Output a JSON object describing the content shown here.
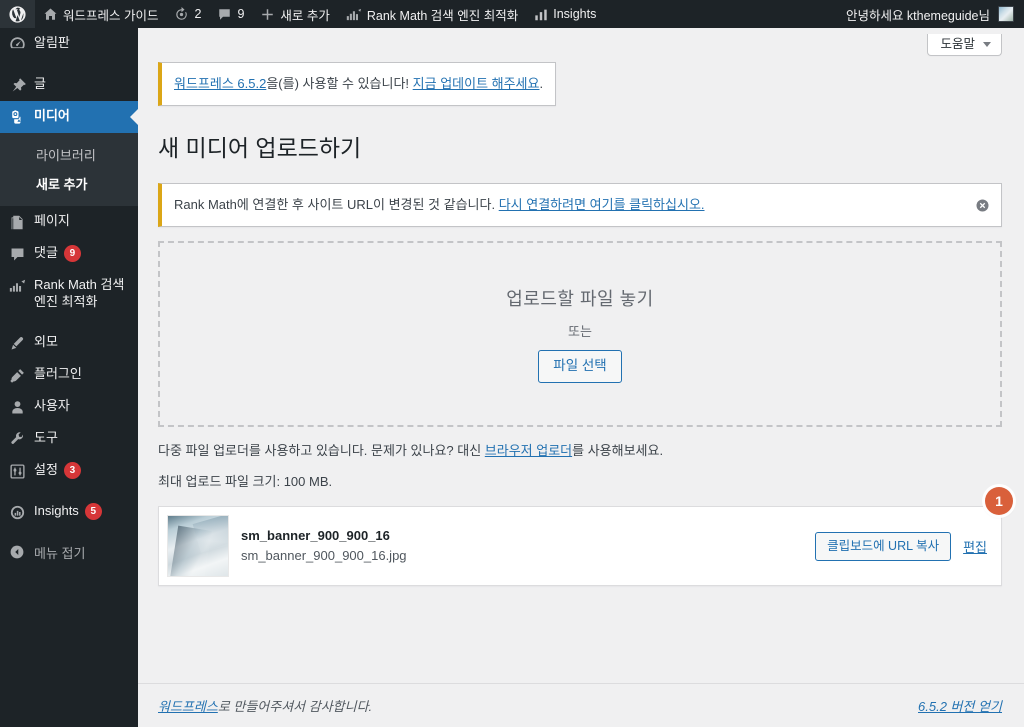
{
  "adminbar": {
    "wp_logo": "wordpress-logo",
    "site_name": "워드프레스 가이드",
    "updates_count": "2",
    "comments_count": "9",
    "new_label": "새로 추가",
    "rankmath_label": "Rank Math 검색 엔진 최적화",
    "insights_label": "Insights",
    "greeting": "안녕하세요 kthemeguide님"
  },
  "sidebar": {
    "items": [
      {
        "label": "알림판",
        "icon": "dashboard-icon",
        "badge": ""
      },
      {
        "label": "글",
        "icon": "pin-icon",
        "badge": ""
      },
      {
        "label": "미디어",
        "icon": "media-camera-icon",
        "badge": "",
        "current": true
      },
      {
        "label": "페이지",
        "icon": "page-icon",
        "badge": ""
      },
      {
        "label": "댓글",
        "icon": "comment-icon",
        "badge": "9"
      },
      {
        "label": "Rank Math 검색 엔진 최적화",
        "icon": "rankmath-icon",
        "badge": ""
      },
      {
        "label": "외모",
        "icon": "appearance-brush-icon",
        "badge": ""
      },
      {
        "label": "플러그인",
        "icon": "plugin-plug-icon",
        "badge": ""
      },
      {
        "label": "사용자",
        "icon": "user-icon",
        "badge": ""
      },
      {
        "label": "도구",
        "icon": "tools-wrench-icon",
        "badge": ""
      },
      {
        "label": "설정",
        "icon": "settings-sliders-icon",
        "badge": "3"
      },
      {
        "label": "Insights",
        "icon": "insights-icon",
        "badge": "5"
      }
    ],
    "submenu": [
      {
        "label": "라이브러리",
        "current": false
      },
      {
        "label": "새로 추가",
        "current": true
      }
    ],
    "collapse_label": "메뉴 접기"
  },
  "screen_meta": {
    "help_label": "도움말"
  },
  "update_nag": {
    "link_version": "워드프레스 6.5.2",
    "text_middle": "을(를) 사용할 수 있습니다! ",
    "link_action": "지금 업데이트 해주세요",
    "text_end": "."
  },
  "page": {
    "title": "새 미디어 업로드하기"
  },
  "rankmath_notice": {
    "text_before": "Rank Math에 연결한 후 사이트 URL이 변경된 것 같습니다. ",
    "link": "다시 연결하려면 여기를 클릭하십시오.",
    "dismiss_icon": "dismiss-circle-x-icon"
  },
  "dropzone": {
    "title": "업로드할 파일 놓기",
    "or": "또는",
    "select_button": "파일 선택"
  },
  "upload_help": {
    "text_before": "다중 파일 업로더를 사용하고 있습니다. 문제가 있나요? 대신 ",
    "link": "브라우저 업로더",
    "text_after": "를 사용해보세요.",
    "max_size": "최대 업로드 파일 크기: 100 MB."
  },
  "media_item": {
    "thumbnail_alt": "sm_banner_900_900_16 썸네일",
    "title": "sm_banner_900_900_16",
    "filename": "sm_banner_900_900_16.jpg",
    "copy_url_button": "클립보드에 URL 복사",
    "edit_link": "편집",
    "annotation_badge": "1"
  },
  "footer": {
    "credit_link": "워드프레스",
    "credit_text": "로 만들어주셔서 감사합니다.",
    "version_link": "6.5.2 버전 얻기"
  },
  "colors": {
    "admin_dark": "#1d2327",
    "admin_submenu": "#2c3338",
    "accent_blue": "#2271b1",
    "link_blue": "#2271b1",
    "badge_red": "#d63638",
    "notice_yellow": "#dba617",
    "annotation_orange": "#d9603b",
    "body_bg": "#f0f0f1"
  }
}
